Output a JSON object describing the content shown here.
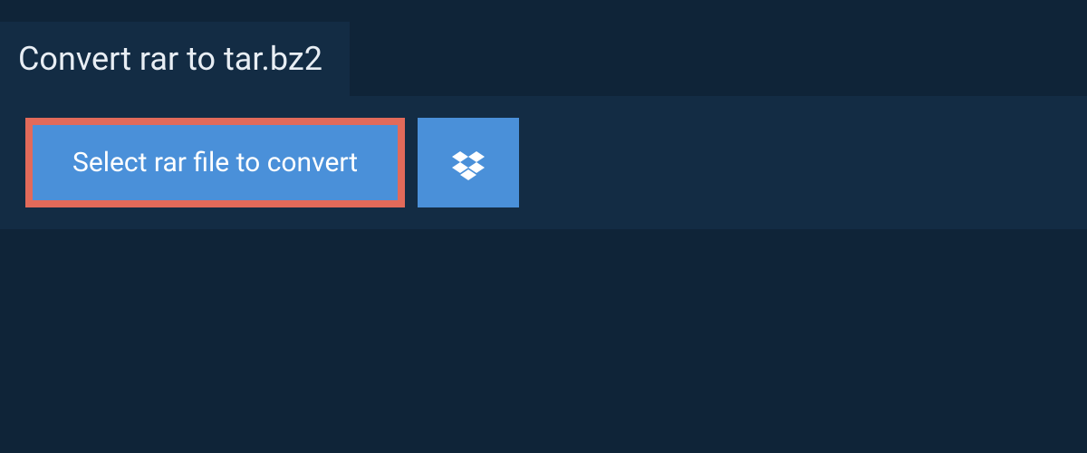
{
  "header": {
    "title": "Convert rar to tar.bz2"
  },
  "actions": {
    "select_file_label": "Select rar file to convert",
    "dropbox_aria": "Select from Dropbox"
  },
  "colors": {
    "page_bg": "#0f2438",
    "panel_bg": "#132c44",
    "button_bg": "#4a90d9",
    "highlight_border": "#e26a5a",
    "text_light": "#e8eef4",
    "text_white": "#ffffff"
  }
}
